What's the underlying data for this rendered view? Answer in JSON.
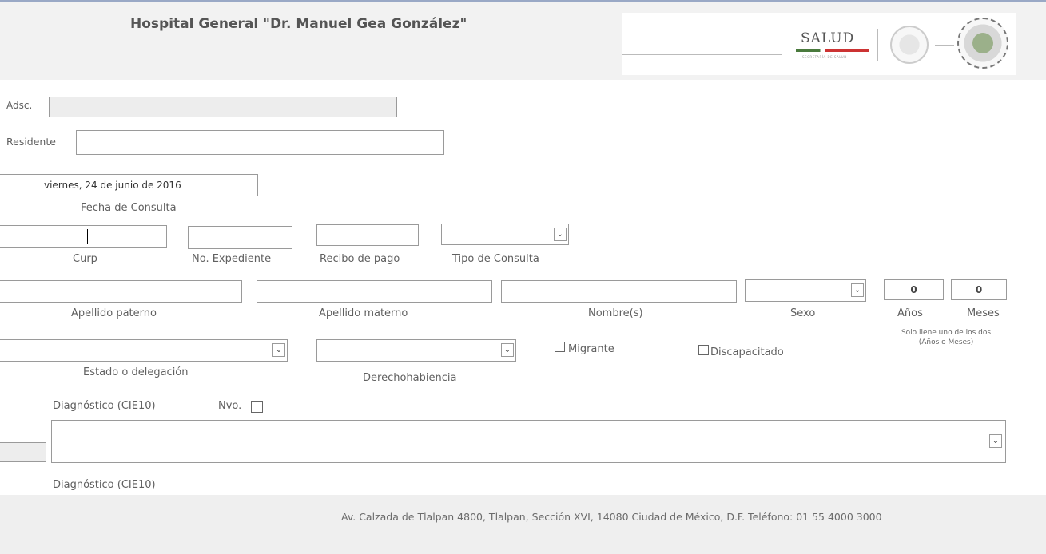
{
  "header": {
    "title": "Hospital General \"Dr. Manuel Gea González\"",
    "logo_text": "SALUD",
    "logo_subtext": "SECRETARÍA DE SALUD"
  },
  "form": {
    "adsc_label": "Adsc.",
    "adsc_value": "",
    "residente_label": "Residente",
    "residente_value": "",
    "fecha_value": "viernes, 24 de junio de 2016",
    "fecha_label": "Fecha de Consulta",
    "curp_label": "Curp",
    "curp_value": "",
    "expediente_label": "No. Expediente",
    "expediente_value": "",
    "recibo_label": "Recibo de pago",
    "recibo_value": "",
    "tipo_label": "Tipo de Consulta",
    "tipo_value": "",
    "apellido_paterno_label": "Apellido paterno",
    "apellido_materno_label": "Apellido materno",
    "nombre_label": "Nombre(s)",
    "sexo_label": "Sexo",
    "anos_value": "0",
    "meses_value": "0",
    "anos_label": "Años",
    "meses_label": "Meses",
    "edad_note_line1": "Solo llene uno de los dos",
    "edad_note_line2": "(Años o Meses)",
    "estado_label": "Estado o delegación",
    "derecho_label": "Derechohabiencia",
    "migrante_label": "Migrante",
    "discapacitado_label": "Discapacitado",
    "diag1_label": "Diagnóstico (CIE10)",
    "nvo_label": "Nvo.",
    "diag2_label": "Diagnóstico (CIE10)"
  },
  "footer": {
    "address": "Av. Calzada de Tlalpan 4800, Tlalpan, Sección XVI, 14080 Ciudad de México, D.F. Teléfono: 01 55 4000 3000"
  },
  "icons": {
    "dropdown": "chevron-down-icon",
    "checkbox": "checkbox-unchecked-icon"
  },
  "colors": {
    "header_bg": "#f2f2f2",
    "footer_bg": "#efefef",
    "border": "#9a9a9a"
  }
}
